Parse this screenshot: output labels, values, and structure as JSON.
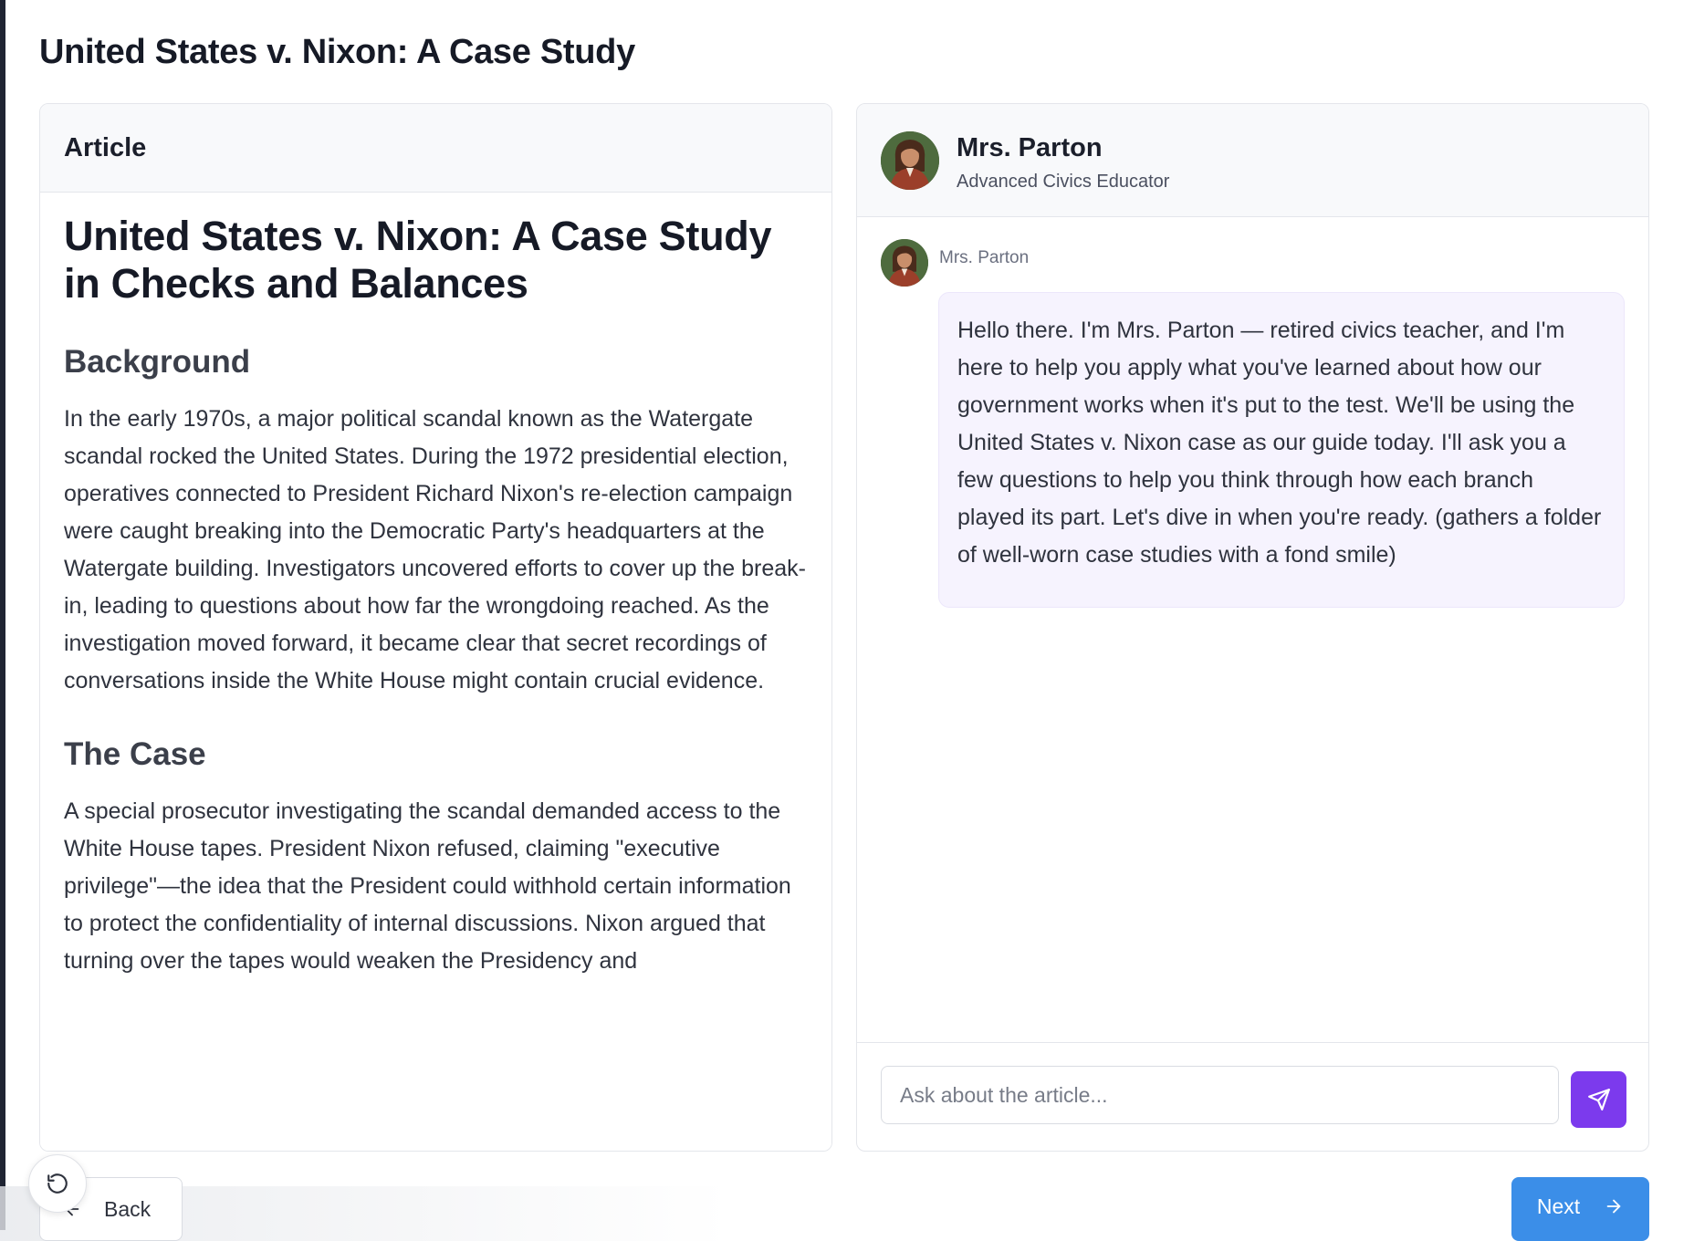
{
  "page": {
    "title": "United States v. Nixon: A Case Study"
  },
  "article": {
    "panel_label": "Article",
    "heading": "United States v. Nixon: A Case Study in Checks and Balances",
    "sections": [
      {
        "heading": "Background",
        "text": "In the early 1970s, a major political scandal known as the Watergate scandal rocked the United States. During the 1972 presidential election, operatives connected to President Richard Nixon's re-election campaign were caught breaking into the Democratic Party's headquarters at the Watergate building. Investigators uncovered efforts to cover up the break-in, leading to questions about how far the wrongdoing reached. As the investigation moved forward, it became clear that secret recordings of conversations inside the White House might contain crucial evidence."
      },
      {
        "heading": "The Case",
        "text": "A special prosecutor investigating the scandal demanded access to the White House tapes. President Nixon refused, claiming \"executive privilege\"—the idea that the President could withhold certain information to protect the confidentiality of internal discussions. Nixon argued that turning over the tapes would weaken the Presidency and"
      }
    ]
  },
  "chat": {
    "tutor_name": "Mrs. Parton",
    "tutor_role": "Advanced Civics Educator",
    "messages": [
      {
        "sender": "Mrs. Parton",
        "text": "Hello there. I'm Mrs. Parton — retired civics teacher, and I'm here to help you apply what you've learned about how our government works when it's put to the test. We'll be using the United States v. Nixon case as our guide today. I'll ask you a few questions to help you think through how each branch played its part. Let's dive in when you're ready. (gathers a folder of well-worn case studies with a fond smile)"
      }
    ],
    "input_placeholder": "Ask about the article...",
    "input_value": "",
    "send_icon": "send-icon"
  },
  "nav": {
    "back_label": "Back",
    "next_label": "Next",
    "reset_icon": "reset-icon"
  },
  "colors": {
    "accent_purple": "#7c3aed",
    "next_blue": "#3b8ee8",
    "bubble_bg": "#f6f3fe",
    "header_bg": "#f8f9fb"
  }
}
